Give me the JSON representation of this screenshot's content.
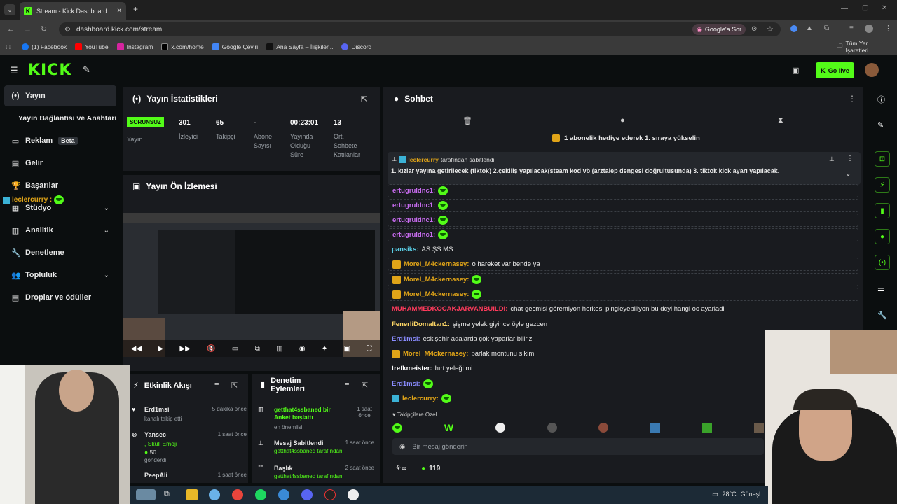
{
  "browser": {
    "tab_title": "Stream - Kick Dashboard",
    "url": "dashboard.kick.com/stream",
    "google_sor": "Google'a Sor",
    "bookmarks": [
      "(1) Facebook",
      "YouTube",
      "Instagram",
      "x.com/home",
      "Google Çeviri",
      "Ana Sayfa – İlişkiler...",
      "Discord"
    ],
    "all_bookmarks": "Tüm Yer İşaretleri"
  },
  "header": {
    "logo": "KICK",
    "go_live": "Go live"
  },
  "sidebar": {
    "items": [
      {
        "label": "Yayın",
        "icon": "(•)"
      },
      {
        "label": "Yayın Bağlantısı ve Anahtarı"
      },
      {
        "label": "Reklam",
        "icon": "▭",
        "badge": "Beta"
      },
      {
        "label": "Gelir",
        "icon": "▤"
      },
      {
        "label": "Başarılar",
        "icon": "🏆"
      },
      {
        "label": "Stüdyo",
        "icon": "▦"
      },
      {
        "label": "Analitik",
        "icon": "▥"
      },
      {
        "label": "Denetleme",
        "icon": "🔧"
      },
      {
        "label": "Topluluk",
        "icon": "👥"
      },
      {
        "label": "Droplar ve ödüller",
        "icon": "▤"
      }
    ],
    "overlay_user": "leclercurry :"
  },
  "stats": {
    "title": "Yayın İstatistikleri",
    "status_badge": "SORUNSUZ",
    "status_label": "Yayın",
    "cols": [
      {
        "value": "301",
        "label": "İzleyici"
      },
      {
        "value": "65",
        "label": "Takipçi"
      },
      {
        "value": "-",
        "label": "Abone Sayısı"
      },
      {
        "value": "00:23:01",
        "label": "Yayında Olduğu Süre"
      },
      {
        "value": "13",
        "label": "Ort. Sohbete Katılanlar"
      }
    ]
  },
  "preview": {
    "title": "Yayın Ön İzlemesi"
  },
  "activity": {
    "title": "Etkinlik Akışı",
    "items": [
      {
        "user": "Erd1msi",
        "text": "kanalı takip etti",
        "time": "5 dakika önce"
      },
      {
        "user": "Yansec",
        "text": ", Skull Emoji",
        "extra": "50",
        "extra2": "gönderdi",
        "time": "1 saat önce"
      },
      {
        "user": "PeepAli",
        "text": "",
        "time": "1 saat önce"
      }
    ]
  },
  "moderation": {
    "title": "Denetim Eylemleri",
    "items": [
      {
        "title": "getthat4ssbaned bir Anket başlattı",
        "sub": "en önemlisi",
        "time": "1 saat önce"
      },
      {
        "title": "Mesaj Sabitlendi",
        "sub": "getthat4ssbaned tarafından",
        "time": "1 saat önce"
      },
      {
        "title": "Başlık",
        "sub": "getthat4ssbaned tarafından",
        "time": "2 saat önce"
      }
    ]
  },
  "chat": {
    "title": "Sohbet",
    "sub_banner": "1 abonelik hediye ederek 1. sıraya yükselin",
    "pinned_by": "leclercurry",
    "pinned_suffix": "tarafından sabitlendi",
    "pinned_text": "1. kızlar yayına getirilecek (tiktok) 2.çekiliş yapılacak(steam kod vb (arztalep dengesi doğrultusunda) 3. tiktok kick ayarı yapılacak.",
    "messages": [
      {
        "user": "ertugruldnc1:",
        "color": "#c86cf0",
        "text": "",
        "emote": true,
        "hl": true
      },
      {
        "user": "ertugruldnc1:",
        "color": "#c86cf0",
        "text": "",
        "emote": true,
        "hl": true
      },
      {
        "user": "ertugruldnc1:",
        "color": "#c86cf0",
        "text": "",
        "emote": true,
        "hl": true
      },
      {
        "user": "ertugruldnc1:",
        "color": "#c86cf0",
        "text": "",
        "emote": true,
        "hl": true
      },
      {
        "user": "pansiks:",
        "color": "#5ad0e8",
        "text": "AS ŞS MS",
        "emote": false,
        "hl": false
      },
      {
        "user": "Morel_M4ckernasey:",
        "color": "#e0a418",
        "text": "o hareket var bende ya",
        "emote": false,
        "hl": true,
        "crown": true
      },
      {
        "user": "Morel_M4ckernasey:",
        "color": "#e0a418",
        "text": "",
        "emote": true,
        "hl": true,
        "crown": true
      },
      {
        "user": "Morel_M4ckernasey:",
        "color": "#e0a418",
        "text": "",
        "emote": true,
        "hl": true,
        "crown": true
      },
      {
        "user": "MUHAMMEDKOCAKJARVANBUILDI:",
        "color": "#ff3b5c",
        "text": "chat gecmisi göremiyon herkesi pingleyebiliyon bu dcyi hangi oc ayarladi",
        "emote": false,
        "hl": false
      },
      {
        "user": "FenerliDomaltan1:",
        "color": "#ffd866",
        "text": "şişme yelek giyince öyle gezcen",
        "emote": false,
        "hl": false
      },
      {
        "user": "Erd1msi:",
        "color": "#8a8cff",
        "text": "eskişehir adalarda çok yaparlar biliriz",
        "emote": false,
        "hl": false
      },
      {
        "user": "Morel_M4ckernasey:",
        "color": "#e0a418",
        "text": "parlak montunu sikim",
        "emote": false,
        "hl": false,
        "crown": true
      },
      {
        "user": "trefkmeister:",
        "color": "#ffffff",
        "text": "hırt yeleği mi",
        "emote": false,
        "hl": false
      },
      {
        "user": "Erd1msi:",
        "color": "#8a8cff",
        "text": "",
        "emote": true,
        "hl": false
      },
      {
        "user": "leclercurry:",
        "color": "#e0a418",
        "text": "",
        "emote": true,
        "hl": false,
        "badge": true
      }
    ],
    "emote_label": "Takipçilere Özel",
    "input_placeholder": "Bir mesaj gönderin",
    "viewer_count": "119"
  },
  "taskbar": {
    "weather": "28°C",
    "weather_text": "Güneşl"
  }
}
